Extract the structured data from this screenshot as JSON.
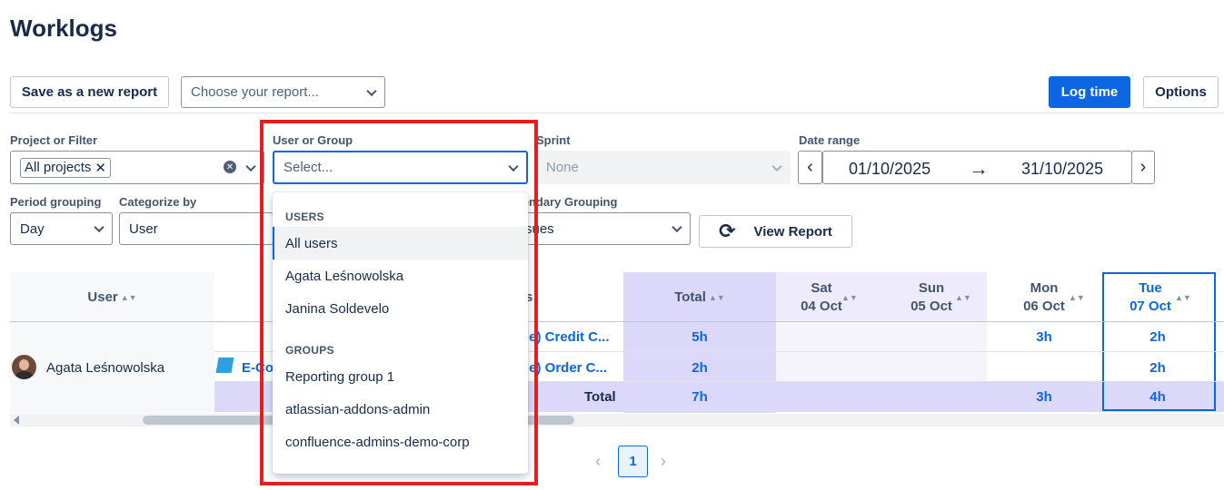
{
  "page": {
    "title": "Worklogs"
  },
  "toolbar": {
    "save_report": "Save as a new report",
    "report_placeholder": "Choose your report...",
    "log_time": "Log time",
    "options": "Options"
  },
  "filters": {
    "project_label": "Project or Filter",
    "project_tag": "All projects",
    "user_label": "User or Group",
    "user_placeholder": "Select...",
    "sprint_label": "Sprint",
    "sprint_value": "None",
    "date_label": "Date range",
    "date_from": "01/10/2025",
    "date_to": "31/10/2025",
    "period_label": "Period grouping",
    "period_value": "Day",
    "categorize_label": "Categorize by",
    "categorize_value": "User",
    "secondary_label": "ondary Grouping",
    "secondary_value": "sues",
    "view_report": "View Report"
  },
  "table": {
    "col_user": "User",
    "col_issues_fragment": "s",
    "col_total": "Total",
    "days": [
      {
        "dow": "Sat",
        "date": "04 Oct"
      },
      {
        "dow": "Sun",
        "date": "05 Oct"
      },
      {
        "dow": "Mon",
        "date": "06 Oct"
      },
      {
        "dow": "Tue",
        "date": "07 Oct"
      }
    ],
    "user_name": "Agata Leśnowolska",
    "project_fragment": "E-Co",
    "rows": [
      {
        "issue": "le) Credit C...",
        "total": "5h",
        "mon": "3h",
        "tue": "2h"
      },
      {
        "issue": "le) Order C...",
        "total": "2h",
        "mon": "",
        "tue": "2h"
      }
    ],
    "total_label": "Total",
    "total_sum": "7h",
    "total_mon": "3h",
    "total_tue": "4h"
  },
  "pagination": {
    "current": "1"
  },
  "dropdown": {
    "users_heading": "USERS",
    "users": [
      "All users",
      "Agata Leśnowolska",
      "Janina Soldevelo"
    ],
    "groups_heading": "GROUPS",
    "groups": [
      "Reporting group 1",
      "atlassian-addons-admin",
      "confluence-admins-demo-corp"
    ]
  },
  "colors": {
    "primary": "#0c66e4",
    "highlight": "#e02020",
    "total_bg": "#dcd8fa",
    "weekend_bg": "#eeecfc"
  }
}
